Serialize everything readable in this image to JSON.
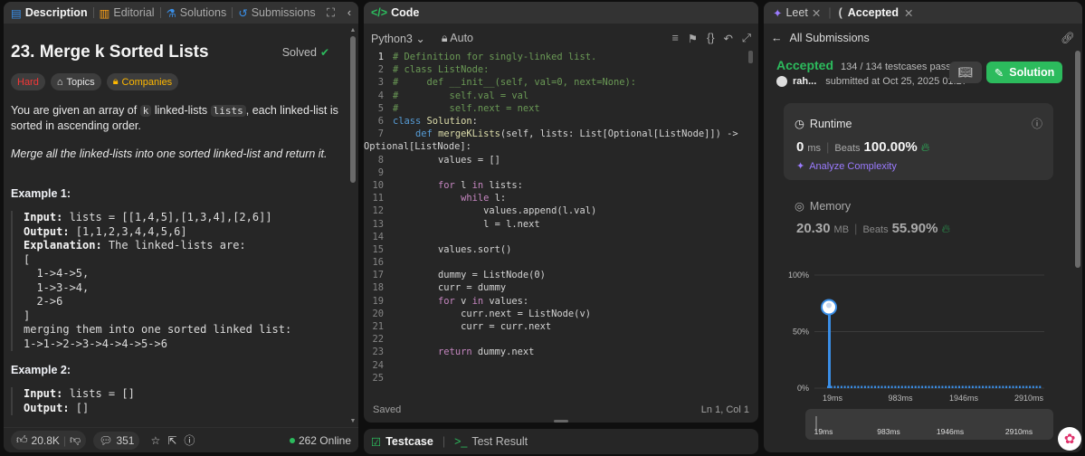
{
  "left": {
    "tabs": [
      "Description",
      "Editorial",
      "Solutions",
      "Submissions"
    ],
    "title": "23. Merge k Sorted Lists",
    "solved_label": "Solved",
    "badges": [
      "Hard",
      "Topics",
      "Companies"
    ],
    "desc_p1_a": "You are given an array of",
    "desc_p1_k": "k",
    "desc_p1_b": "linked-lists",
    "desc_p1_lists": "lists",
    "desc_p1_c": ", each linked-list is sorted in ascending order.",
    "desc_p2": "Merge all the linked-lists into one sorted linked-list and return it.",
    "example1_title": "Example 1:",
    "example1": {
      "input_label": "Input:",
      "input_value": " lists = [[1,4,5],[1,3,4],[2,6]]",
      "output_label": "Output:",
      "output_value": " [1,1,2,3,4,4,5,6]",
      "explanation_label": "Explanation:",
      "explanation_value": " The linked-lists are:",
      "lines": [
        "[",
        "  1->4->5,",
        "  1->3->4,",
        "  2->6",
        "]",
        "merging them into one sorted linked list:",
        "1->1->2->3->4->4->5->6"
      ]
    },
    "example2_title": "Example 2:",
    "example2": {
      "input_label": "Input:",
      "input_value": " lists = []",
      "output_label": "Output:",
      "output_value": " []"
    },
    "footer": {
      "likes": "20.8K",
      "comments": "351",
      "online": "262 Online"
    }
  },
  "mid": {
    "tab": "Code",
    "language": "Python3",
    "mode": "Auto",
    "status": "Saved",
    "cursor": "Ln 1, Col 1",
    "bottom_tabs": [
      "Testcase",
      "Test Result"
    ]
  },
  "right": {
    "tabs": [
      "Leet",
      "Accepted"
    ],
    "back_label": "All Submissions",
    "status": "Accepted",
    "testcases": "134 / 134 testcases passed",
    "user": "rah...",
    "submitted": "submitted at Oct 25, 2025 01:27",
    "solution_label": "Solution",
    "runtime": {
      "label": "Runtime",
      "value": "0",
      "unit": "ms",
      "beats_label": "Beats",
      "beats": "100.00%",
      "analyze": "Analyze Complexity"
    },
    "memory": {
      "label": "Memory",
      "value": "20.30",
      "unit": "MB",
      "beats_label": "Beats",
      "beats": "55.90%"
    }
  },
  "chart_data": {
    "type": "bar",
    "ylim": [
      0,
      100
    ],
    "yticks": [
      "100%",
      "50%",
      "0%"
    ],
    "xticks": [
      "19ms",
      "983ms",
      "1946ms",
      "2910ms"
    ],
    "highlight": {
      "x": "19ms",
      "value": 78
    },
    "baseline_value": 2,
    "minimap_ticks": [
      "19ms",
      "983ms",
      "1946ms",
      "2910ms"
    ]
  },
  "colors": {
    "accent_green": "#2cbb5d",
    "hard_red": "#f63737",
    "companies_gold": "#ffb800",
    "chart_blue": "#3a8ee6"
  }
}
